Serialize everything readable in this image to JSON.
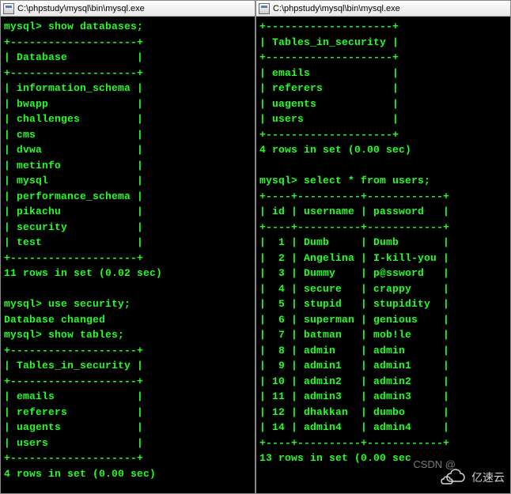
{
  "left": {
    "title": "C:\\phpstudy\\mysql\\bin\\mysql.exe",
    "prompt": "mysql>",
    "cmd_show_db": "show databases;",
    "db_border_top": "+--------------------+",
    "db_header": "| Database           |",
    "databases": [
      "| information_schema |",
      "| bwapp              |",
      "| challenges         |",
      "| cms                |",
      "| dvwa               |",
      "| metinfo            |",
      "| mysql              |",
      "| performance_schema |",
      "| pikachu            |",
      "| security           |",
      "| test               |"
    ],
    "db_count_msg": "11 rows in set (0.02 sec)",
    "cmd_use": "use security;",
    "db_changed": "Database changed",
    "cmd_show_tables": "show tables;",
    "tbl_border": "+--------------------+",
    "tbl_header": "| Tables_in_security |",
    "tables": [
      "| emails             |",
      "| referers           |",
      "| uagents            |",
      "| users              |"
    ],
    "tbl_count_msg": "4 rows in set (0.00 sec)"
  },
  "right": {
    "title": "C:\\phpstudy\\mysql\\bin\\mysql.exe",
    "prompt": "mysql>",
    "tbl_border": "+--------------------+",
    "tbl_header": "| Tables_in_security |",
    "tables": [
      "| emails             |",
      "| referers           |",
      "| uagents            |",
      "| users              |"
    ],
    "tbl_count_msg": "4 rows in set (0.00 sec)",
    "cmd_select": "select * from users;",
    "users_border": "+----+----------+------------+",
    "users_header": "| id | username | password   |",
    "users": [
      "|  1 | Dumb     | Dumb       |",
      "|  2 | Angelina | I-kill-you |",
      "|  3 | Dummy    | p@ssword   |",
      "|  4 | secure   | crappy     |",
      "|  5 | stupid   | stupidity  |",
      "|  6 | superman | genious    |",
      "|  7 | batman   | mob!le     |",
      "|  8 | admin    | admin      |",
      "|  9 | admin1   | admin1     |",
      "| 10 | admin2   | admin2     |",
      "| 11 | admin3   | admin3     |",
      "| 12 | dhakkan  | dumbo      |",
      "| 14 | admin4   | admin4     |"
    ],
    "users_count_msg": "13 rows in set (0.00 sec"
  },
  "watermark_csdn": "CSDN @",
  "watermark_yisu": "亿速云"
}
